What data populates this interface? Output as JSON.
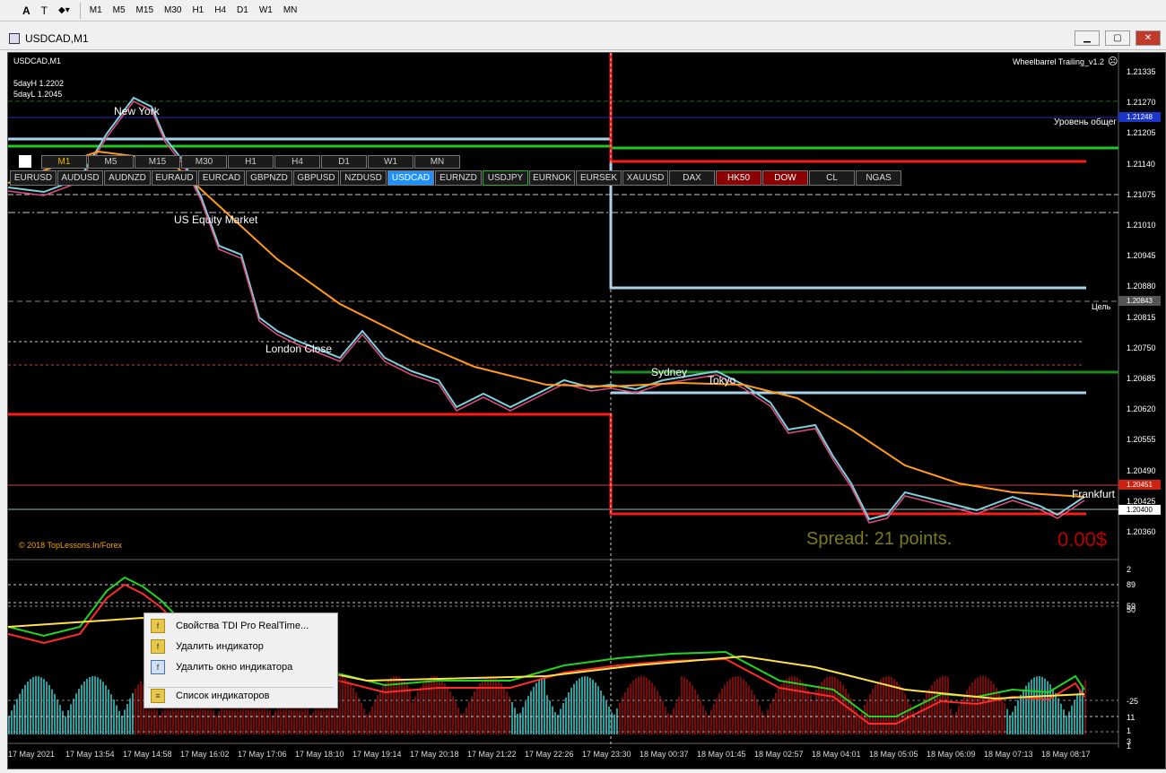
{
  "toolbar": {
    "font_btn": "A",
    "text_btn": "T",
    "timeframes": [
      "M1",
      "M5",
      "M15",
      "M30",
      "H1",
      "H4",
      "D1",
      "W1",
      "MN"
    ]
  },
  "window": {
    "title": "USDCAD,M1"
  },
  "chart": {
    "symbol_label": "USDCAD,M1",
    "five_day_high": "5dayH 1.2202",
    "five_day_low": "5dayL 1.2045",
    "indicator_name": "Wheelbarrel Trailing_v1.2",
    "copyright": "© 2018 TopLessons.In/Forex",
    "spread_text": "Spread: 21 points.",
    "profit_text": "0.00$",
    "level_label": "Уровень общег",
    "target_label": "Цель",
    "sessions": {
      "new_york": "New York",
      "us_equity": "US Equity Market",
      "london": "London Close",
      "sydney": "Sydney",
      "tokyo": "Tokyo",
      "frankfurt": "Frankfurt"
    },
    "tf_buttons": [
      "M1",
      "M5",
      "M15",
      "M30",
      "H1",
      "H4",
      "D1",
      "W1",
      "MN"
    ],
    "symbols": [
      "EURUSD",
      "AUDUSD",
      "AUDNZD",
      "EURAUD",
      "EURCAD",
      "GBPNZD",
      "GBPUSD",
      "NZDUSD",
      "USDCAD",
      "EURNZD",
      "USDJPY",
      "EURNOK",
      "EURSEK",
      "XAUUSD",
      "DAX",
      "HK50",
      "DOW",
      "CL",
      "NGAS"
    ],
    "price_ticks": [
      "1.21335",
      "1.21270",
      "1.21205",
      "1.21140",
      "1.21075",
      "1.21010",
      "1.20945",
      "1.20880",
      "1.20815",
      "1.20750",
      "1.20685",
      "1.20620",
      "1.20555",
      "1.20490",
      "1.20425",
      "1.20360"
    ],
    "price_tags": {
      "blue": "1.21248",
      "grey": "1.20843",
      "red": "1.20451",
      "white": "1.20400"
    },
    "sub_ticks": [
      "2",
      "89",
      "59",
      "50",
      "-25",
      "11",
      "1",
      "3",
      "1"
    ],
    "time_ticks": [
      "17 May 2021",
      "17 May 13:54",
      "17 May 14:58",
      "17 May 16:02",
      "17 May 17:06",
      "17 May 18:10",
      "17 May 19:14",
      "17 May 20:18",
      "17 May 21:22",
      "17 May 22:26",
      "17 May 23:30",
      "18 May 00:37",
      "18 May 01:45",
      "18 May 02:57",
      "18 May 04:01",
      "18 May 05:05",
      "18 May 06:09",
      "18 May 07:13",
      "18 May 08:17"
    ],
    "colors": {
      "background": "#000000",
      "red_line": "#ff1a1a",
      "green_line": "#22c922",
      "light_blue": "#aad4ea",
      "orange_ma": "#ff9a1a",
      "selected_symbol": "#1e90ff"
    }
  },
  "context_menu": {
    "items": [
      {
        "label": "Свойства TDI Pro RealTime..."
      },
      {
        "label": "Удалить индикатор"
      },
      {
        "label": "Удалить окно индикатора"
      },
      {
        "label": "Список индикаторов"
      }
    ]
  }
}
